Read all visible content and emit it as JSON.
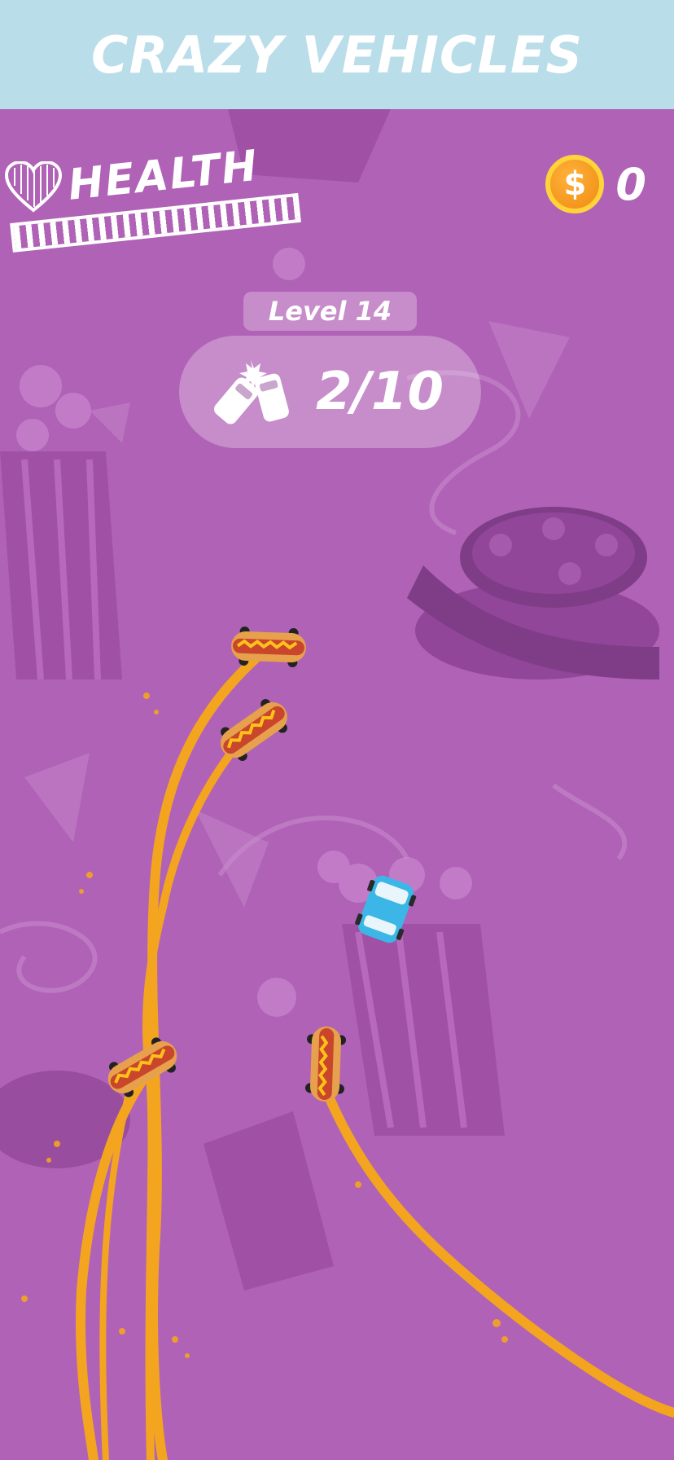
{
  "banner": {
    "title": "CRAZY VEHICLES"
  },
  "hud": {
    "health_label": "HEALTH",
    "health_fraction": 1.0,
    "coin_symbol": "$",
    "coins": "0",
    "level_label": "Level 14",
    "crash_count": "2/10"
  },
  "colors": {
    "banner_bg": "#b9dde9",
    "play_bg": "#b062b6",
    "mustard_trail": "#f4a51f",
    "player_car": "#3cb6e6",
    "coin": "#f08a12"
  },
  "icons": [
    "heart-icon",
    "coin-icon",
    "crash-cars-icon",
    "hotdog-car",
    "player-car"
  ]
}
